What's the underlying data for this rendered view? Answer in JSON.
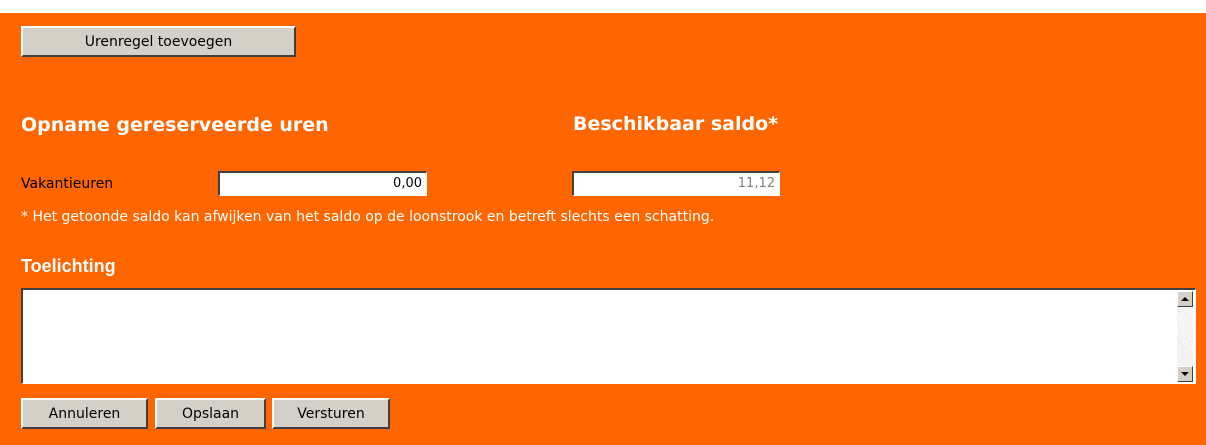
{
  "colors": {
    "panel_background": "#ff6600",
    "heading_text": "#ffffff",
    "button_face": "#d4d0c8"
  },
  "toolbar": {
    "add_hour_line_label": "Urenregel toevoegen"
  },
  "headings": {
    "withdrawal": "Opname gereserveerde uren",
    "available_balance": "Beschikbaar saldo*",
    "explanation": "Toelichting"
  },
  "row": {
    "label": "Vakantieuren",
    "hours_value": "0,00",
    "balance_value": "11,12"
  },
  "footnote": "* Het getoonde saldo kan afwijken van het saldo op de loonstrook en betreft slechts een schatting.",
  "explanation_text": "",
  "actions": {
    "cancel_label": "Annuleren",
    "save_label": "Opslaan",
    "send_label": "Versturen"
  },
  "icons": {
    "scroll_up": "scroll-up-arrow-icon",
    "scroll_down": "scroll-down-arrow-icon"
  }
}
